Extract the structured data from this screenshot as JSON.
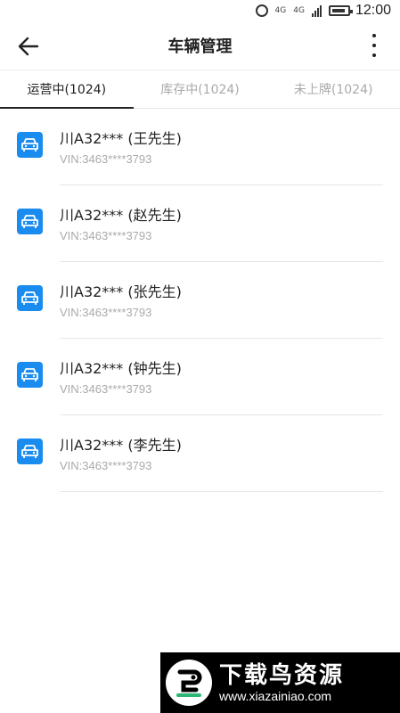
{
  "status": {
    "net1": "4G",
    "net2": "4G",
    "time": "12:00",
    "battery_level": 0.7
  },
  "header": {
    "title": "车辆管理",
    "back_icon": "arrow-left-icon",
    "more_icon": "more-vertical-icon"
  },
  "tabs": [
    {
      "label": "运营中(1024)",
      "active": true
    },
    {
      "label": "库存中(1024)",
      "active": false
    },
    {
      "label": "未上牌(1024)",
      "active": false
    }
  ],
  "vehicles": [
    {
      "plate": "川A32*** (王先生)",
      "vin": "VIN:3463****3793"
    },
    {
      "plate": "川A32*** (赵先生)",
      "vin": "VIN:3463****3793"
    },
    {
      "plate": "川A32*** (张先生)",
      "vin": "VIN:3463****3793"
    },
    {
      "plate": "川A32*** (钟先生)",
      "vin": "VIN:3463****3793"
    },
    {
      "plate": "川A32*** (李先生)",
      "vin": "VIN:3463****3793"
    }
  ],
  "colors": {
    "accent": "#1a8cf0",
    "text_primary": "#222222",
    "text_secondary": "#aaaaaa",
    "divider": "#e6e6e6"
  },
  "watermark": {
    "main": "下载鸟资源",
    "url": "www.xiazainiao.com"
  }
}
